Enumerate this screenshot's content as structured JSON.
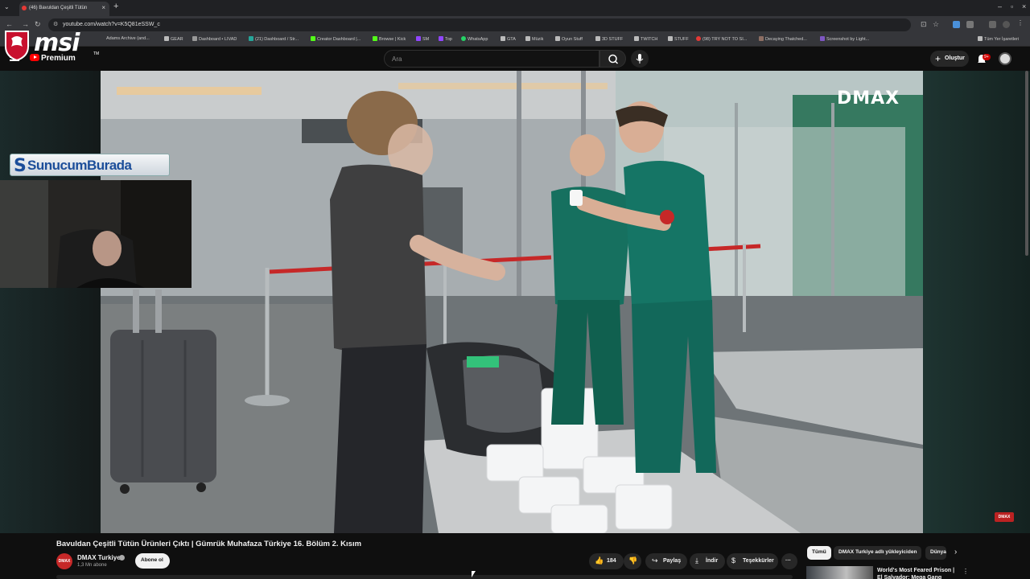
{
  "browser": {
    "tab_title": "(46) Bavuldan Çeşitli Tütün",
    "tab_menu_icon": "chevron-down-icon",
    "url": "youtube.com/watch?v=K5Q81eSSW_c",
    "bookmarks": [
      "Adams Archive (and...",
      "GEAR",
      "Dashboard • LIVAD",
      "(21) Dashboard / Str...",
      "Creator Dashboard |...",
      "Browse | Kick",
      "SM",
      "Top",
      "WhatsApp",
      "GTA",
      "Müzik",
      "Oyun Stuff",
      "3D STUFF",
      "TWITCH",
      "STUFF",
      "(98) TRY NOT TO SI...",
      "Decaying Thatched...",
      "Screenshot by Light..."
    ],
    "all_bookmarks": "Tüm Yer İşaretleri"
  },
  "overlay": {
    "msi_logo": "msi",
    "msi_tm": "TM",
    "cam_banner": "SunucumBurada",
    "cam_banner_initial": "S"
  },
  "youtube": {
    "premium_label": "Premium",
    "search_placeholder": "Ara",
    "create_label": "Oluştur",
    "notification_badge": "9+"
  },
  "video": {
    "watermark": "DMAX",
    "corner_badge": "DMAX",
    "title": "Bavuldan Çeşitli Tütün Ürünleri Çıktı | Gümrük Muhafaza Türkiye 16. Bölüm 2. Kısım",
    "channel_name": "DMAX Turkiye",
    "channel_avatar_text": "DMAX",
    "subscribers": "1,3 Mn abone",
    "subscribe_label": "Abone ol",
    "like_count": "184",
    "share_label": "Paylaş",
    "download_label": "İndir",
    "thanks_label": "Teşekkürler",
    "more_label": "···"
  },
  "chips": [
    "Tümü",
    "DMAX Turkiye adlı yükleyiciden",
    "Dünya"
  ],
  "recommendation": {
    "title": "World's Most Feared Prison | El Salvador: Mega Gang Fortress"
  },
  "colors": {
    "accent_red": "#ff0000",
    "bg": "#0f0f0f",
    "uniform_green": "#0e6b5c"
  }
}
